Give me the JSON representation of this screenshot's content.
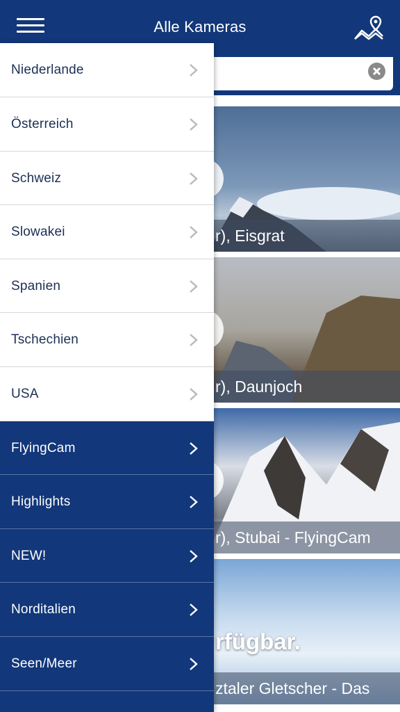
{
  "header": {
    "title": "Alle Kameras",
    "background": "#12377a"
  },
  "icons": {
    "menu": "hamburger-icon",
    "map": "map-pin-icon",
    "clear": "clear-circle-icon",
    "chevron": "chevron-right-icon"
  },
  "cameras": [
    {
      "caption": "r), Eisgrat"
    },
    {
      "caption": "r), Daunjoch"
    },
    {
      "caption": "r), Stubai - FlyingCam"
    },
    {
      "caption": "ztaler Gletscher - Das",
      "overlay_text": "rfügbar."
    }
  ],
  "drawer": {
    "countries": [
      {
        "label": "Niederlande"
      },
      {
        "label": "Österreich"
      },
      {
        "label": "Schweiz"
      },
      {
        "label": "Slowakei"
      },
      {
        "label": "Spanien"
      },
      {
        "label": "Tschechien"
      },
      {
        "label": "USA"
      }
    ],
    "categories": [
      {
        "label": "FlyingCam"
      },
      {
        "label": "Highlights"
      },
      {
        "label": "NEW!"
      },
      {
        "label": "Norditalien"
      },
      {
        "label": "Seen/Meer"
      }
    ]
  }
}
